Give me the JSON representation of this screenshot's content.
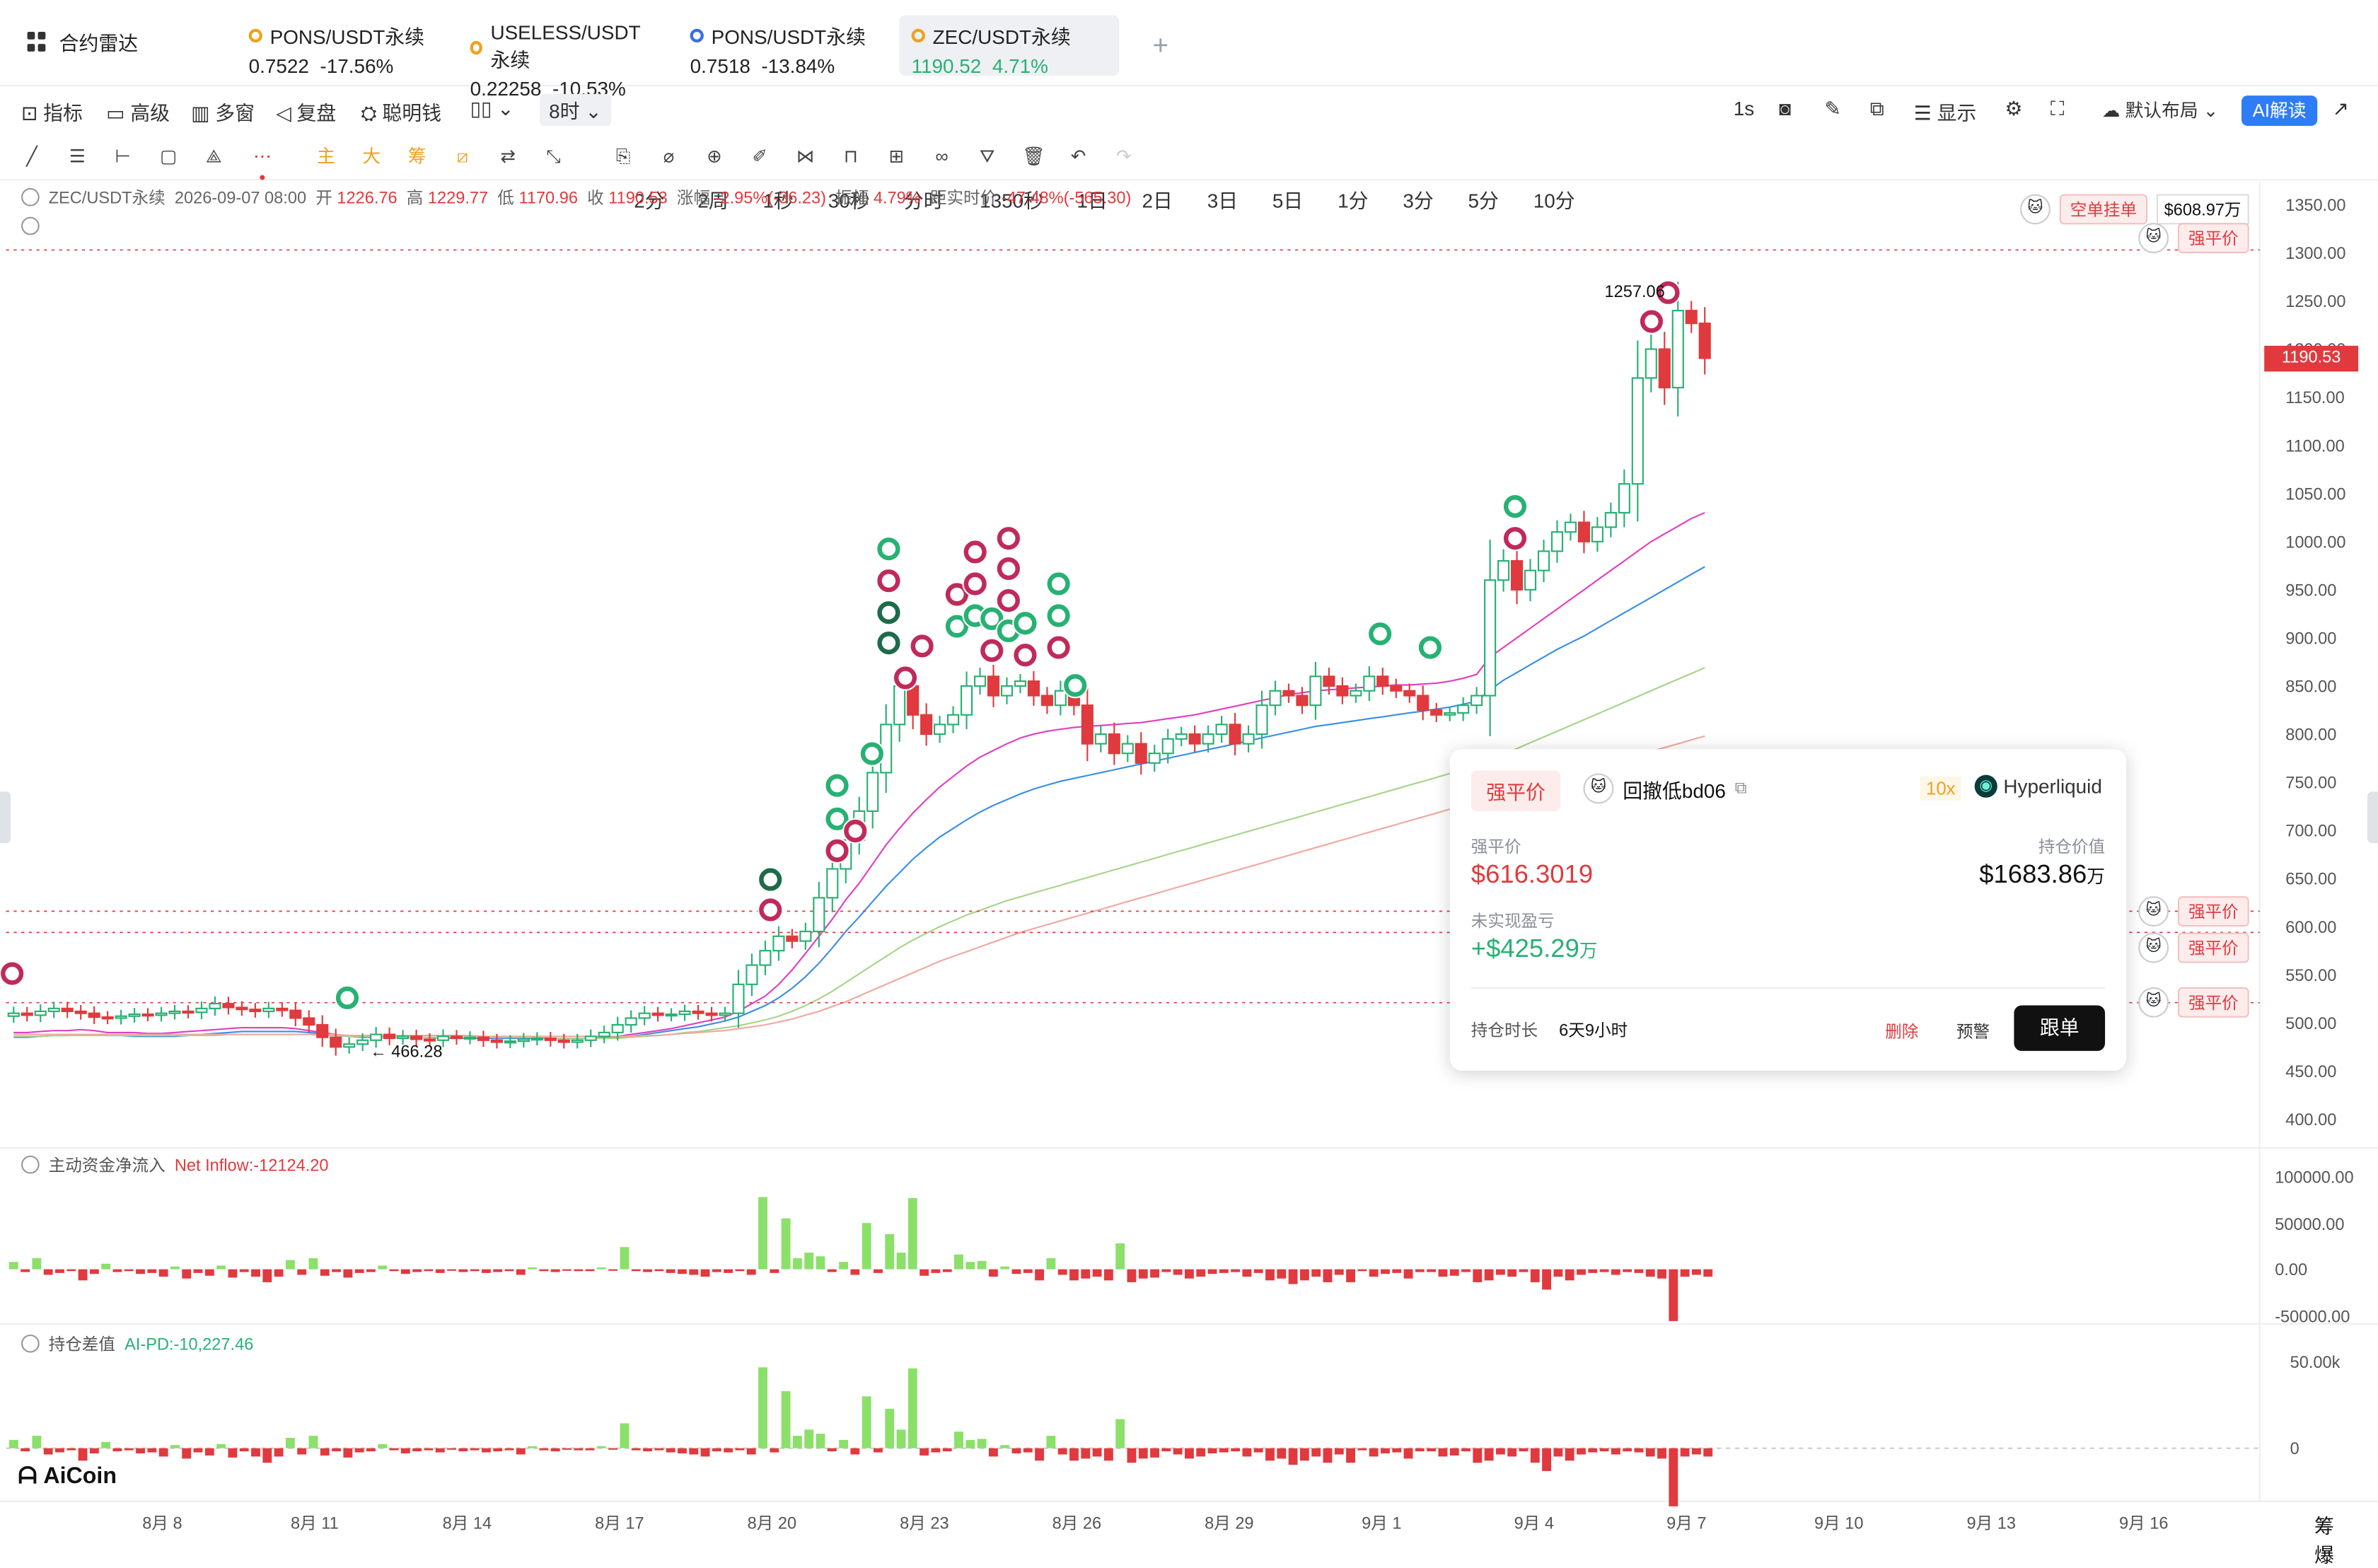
{
  "app": {
    "radar_label": "合约雷达",
    "tabs": [
      {
        "name": "PONS/USDT永续",
        "price": "0.7522",
        "change": "-17.56%",
        "active": false
      },
      {
        "name": "USELESS/USDT永续",
        "price": "0.22258",
        "change": "-10.53%",
        "active": false
      },
      {
        "name": "PONS/USDT永续",
        "price": "0.7518",
        "change": "-13.84%",
        "active": false
      },
      {
        "name": "ZEC/USDT永续",
        "price": "1190.52",
        "change": "4.71%",
        "active": true
      }
    ],
    "plus": "+"
  },
  "toolbar": {
    "left": [
      "指标",
      "高级",
      "多窗",
      "复盘",
      "聪明钱"
    ],
    "interval_selected": "8时",
    "intervals": [
      "2分",
      "2周",
      "1秒",
      "30秒",
      "分时",
      "1350秒",
      "1日",
      "2日",
      "3日",
      "5日",
      "1分",
      "3分",
      "5分",
      "10分"
    ],
    "right_1s": "1s",
    "display": "显示",
    "layout": "默认布局",
    "ai": "AI解读"
  },
  "drawing_tools": {
    "main": "主",
    "big": "大",
    "chips": "筹"
  },
  "info_line": {
    "symbol": "ZEC/USDT永续",
    "datetime": "2026-09-07 08:00",
    "open_label": "开",
    "open": "1226.76",
    "high_label": "高",
    "high": "1229.77",
    "low_label": "低",
    "low": "1170.96",
    "close_label": "收",
    "close": "1190.53",
    "change_label": "涨幅",
    "change": "-2.95%(-36.23)",
    "amp_label": "振幅",
    "amp": "4.79%",
    "dist_label": "距实时价",
    "dist": "-47.48%(-565.30)"
  },
  "price_annotations": {
    "high_mark": "1257.06",
    "low_mark": "← 466.28",
    "last_price": "1190.53",
    "short_order_label": "空单挂单",
    "short_order_value": "$608.97万",
    "liq_label": "强平价"
  },
  "card": {
    "tag": "强平价",
    "user": "回撤低bd06",
    "leverage": "10x",
    "exchange": "Hyperliquid",
    "liq_label": "强平价",
    "liq_value": "$616.3019",
    "pos_label": "持仓价值",
    "pos_value": "$1683.86",
    "pos_unit": "万",
    "pnl_label": "未实现盈亏",
    "pnl_value": "+$425.29",
    "pnl_unit": "万",
    "hold_label": "持仓时长",
    "hold_value": "6天9小时",
    "delete": "删除",
    "alert": "预警",
    "follow": "跟单"
  },
  "panel_labels": {
    "inflow_title": "主动资金净流入",
    "inflow_value": "Net Inflow:-12124.20",
    "pd_title": "持仓差值",
    "pd_value": "AI-PD:-10,227.46",
    "brand": "AiCoin",
    "corner": "筹 爆"
  },
  "colors": {
    "up": "#27b173",
    "down": "#e03a3e",
    "ma1": "#e040c0",
    "ma2": "#3a8ee6",
    "ma3": "#a8d48a",
    "ma4": "#f0a8a0",
    "bar_up": "#8be06a",
    "bar_down": "#e03a3e"
  },
  "chart_data": [
    {
      "type": "candlestick",
      "title": "ZEC/USDT永续 8时",
      "x_ticks": [
        "8月 8",
        "8月 11",
        "8月 14",
        "8月 17",
        "8月 20",
        "8月 23",
        "8月 26",
        "8月 29",
        "9月 1",
        "9月 4",
        "9月 7",
        "9月 10",
        "9月 13",
        "9月 16"
      ],
      "y_ticks": [
        1350,
        1300,
        1250,
        1200,
        1150,
        1100,
        1050,
        1000,
        950,
        900,
        850,
        800,
        750,
        700,
        650,
        600,
        550,
        500,
        450,
        400
      ],
      "ylim": [
        380,
        1370
      ],
      "liquidation_lines": [
        1303,
        616,
        594,
        521
      ],
      "closes": [
        510,
        508,
        512,
        515,
        512,
        510,
        506,
        505,
        507,
        509,
        508,
        510,
        512,
        511,
        515,
        520,
        516,
        514,
        512,
        515,
        513,
        505,
        498,
        485,
        475,
        478,
        482,
        488,
        484,
        486,
        483,
        482,
        486,
        484,
        485,
        482,
        480,
        481,
        483,
        484,
        482,
        480,
        482,
        486,
        490,
        498,
        505,
        510,
        508,
        509,
        512,
        510,
        508,
        510,
        540,
        560,
        575,
        590,
        585,
        595,
        630,
        660,
        690,
        720,
        760,
        810,
        850,
        820,
        800,
        810,
        820,
        850,
        860,
        840,
        850,
        855,
        840,
        830,
        845,
        830,
        790,
        800,
        780,
        790,
        770,
        780,
        795,
        800,
        790,
        800,
        810,
        790,
        800,
        830,
        845,
        840,
        830,
        860,
        850,
        840,
        845,
        860,
        850,
        845,
        840,
        825,
        820,
        822,
        830,
        840,
        960,
        980,
        950,
        970,
        990,
        1010,
        1020,
        1000,
        1015,
        1030,
        1060,
        1170,
        1200,
        1160,
        1240,
        1226.76,
        1190.53
      ],
      "ma_series": [
        {
          "name": "MA1",
          "values": [
            490,
            490,
            491,
            492,
            492,
            493,
            492,
            490,
            490,
            490,
            489,
            489,
            490,
            491,
            492,
            493,
            494,
            495,
            495,
            495,
            495,
            494,
            492,
            490,
            488,
            486,
            486,
            486,
            485,
            485,
            485,
            485,
            485,
            485,
            485,
            485,
            484,
            484,
            484,
            484,
            484,
            484,
            484,
            484,
            485,
            486,
            488,
            490,
            492,
            494,
            497,
            500,
            503,
            506,
            512,
            520,
            528,
            540,
            555,
            572,
            590,
            608,
            628,
            645,
            665,
            685,
            702,
            718,
            732,
            745,
            756,
            767,
            776,
            783,
            790,
            796,
            800,
            803,
            805,
            807,
            808,
            809,
            810,
            811,
            812,
            814,
            816,
            818,
            820,
            823,
            826,
            829,
            832,
            835,
            838,
            841,
            843,
            845,
            846,
            847,
            848,
            849,
            850,
            851,
            851,
            852,
            853,
            855,
            858,
            862,
            880,
            890,
            900,
            910,
            920,
            930,
            940,
            950,
            960,
            970,
            980,
            990,
            1000,
            1008,
            1016,
            1024,
            1030
          ]
        },
        {
          "name": "MA2",
          "values": [
            485,
            485,
            486,
            487,
            487,
            488,
            488,
            487,
            487,
            486,
            486,
            486,
            486,
            487,
            488,
            489,
            490,
            491,
            491,
            491,
            491,
            491,
            490,
            489,
            487,
            486,
            485,
            485,
            485,
            485,
            485,
            485,
            484,
            484,
            484,
            484,
            484,
            484,
            484,
            484,
            484,
            484,
            484,
            484,
            484,
            485,
            486,
            488,
            490,
            492,
            494,
            496,
            499,
            502,
            506,
            512,
            518,
            526,
            536,
            548,
            562,
            578,
            595,
            610,
            626,
            642,
            656,
            670,
            682,
            693,
            702,
            711,
            719,
            726,
            732,
            738,
            743,
            747,
            751,
            754,
            757,
            760,
            763,
            766,
            769,
            772,
            775,
            778,
            781,
            784,
            787,
            790,
            793,
            796,
            799,
            802,
            805,
            808,
            810,
            812,
            814,
            816,
            818,
            820,
            822,
            824,
            826,
            828,
            831,
            834,
            846,
            856,
            864,
            872,
            880,
            888,
            895,
            902,
            910,
            918,
            926,
            934,
            942,
            950,
            958,
            966,
            974
          ]
        },
        {
          "name": "MA3",
          "values": [
            486,
            486,
            486,
            487,
            487,
            487,
            487,
            487,
            487,
            487,
            487,
            487,
            487,
            487,
            487,
            487,
            488,
            488,
            488,
            488,
            488,
            488,
            488,
            487,
            487,
            486,
            486,
            486,
            485,
            485,
            485,
            485,
            485,
            485,
            485,
            485,
            485,
            485,
            485,
            485,
            484,
            484,
            484,
            484,
            484,
            484,
            485,
            486,
            487,
            488,
            490,
            491,
            493,
            495,
            497,
            500,
            503,
            507,
            512,
            518,
            525,
            533,
            542,
            551,
            560,
            569,
            578,
            586,
            593,
            600,
            606,
            612,
            617,
            622,
            627,
            631,
            635,
            639,
            643,
            647,
            651,
            655,
            659,
            663,
            667,
            671,
            675,
            679,
            683,
            687,
            691,
            695,
            699,
            703,
            707,
            711,
            715,
            719,
            723,
            727,
            731,
            735,
            739,
            743,
            747,
            751,
            755,
            759,
            763,
            767,
            773,
            779,
            785,
            791,
            797,
            803,
            809,
            815,
            821,
            827,
            833,
            839,
            845,
            851,
            857,
            863,
            869
          ]
        },
        {
          "name": "MA4",
          "values": [
            488,
            488,
            488,
            488,
            488,
            488,
            488,
            488,
            488,
            488,
            488,
            488,
            488,
            488,
            488,
            488,
            488,
            488,
            488,
            488,
            488,
            488,
            488,
            488,
            488,
            487,
            487,
            487,
            487,
            487,
            487,
            487,
            487,
            487,
            487,
            486,
            486,
            486,
            486,
            486,
            486,
            486,
            486,
            486,
            486,
            486,
            486,
            487,
            487,
            488,
            489,
            490,
            491,
            492,
            494,
            496,
            498,
            501,
            504,
            508,
            512,
            517,
            522,
            528,
            534,
            540,
            546,
            552,
            558,
            564,
            569,
            574,
            579,
            584,
            589,
            594,
            598,
            602,
            606,
            610,
            614,
            618,
            622,
            626,
            630,
            634,
            638,
            642,
            646,
            650,
            654,
            658,
            662,
            666,
            670,
            674,
            678,
            682,
            686,
            690,
            694,
            698,
            702,
            706,
            710,
            714,
            718,
            722,
            726,
            730,
            734,
            738,
            742,
            746,
            750,
            754,
            758,
            762,
            766,
            770,
            774,
            778,
            782,
            786,
            790,
            794,
            798
          ]
        }
      ]
    },
    {
      "type": "bar",
      "title": "主动资金净流入",
      "y_ticks": [
        "100000.00",
        "50000.00",
        "0.00",
        "-50000.00"
      ],
      "ylim": [
        -60000,
        110000
      ],
      "values": [
        8000,
        -3000,
        12000,
        -6000,
        -4000,
        -2000,
        -12000,
        -5000,
        6000,
        -3000,
        -2000,
        -5000,
        -4000,
        -8000,
        3000,
        -10000,
        -4000,
        -7000,
        4000,
        -9000,
        -3000,
        -8000,
        -14000,
        -8000,
        10000,
        -6000,
        12000,
        -7000,
        -3000,
        -9000,
        -4000,
        -3000,
        4000,
        -2000,
        -5000,
        -3000,
        -2000,
        -4000,
        -1000,
        -3000,
        -2000,
        -4000,
        -3000,
        -2000,
        -6000,
        2000,
        -2000,
        -3000,
        -1000,
        -2000,
        -2000,
        2000,
        -1000,
        24000,
        -2000,
        -3000,
        -2000,
        -4000,
        -5000,
        -6000,
        -8000,
        -3000,
        -4000,
        -2000,
        -6000,
        78000,
        -4000,
        55000,
        12000,
        18000,
        14000,
        -3000,
        8000,
        -6000,
        50000,
        -4000,
        38000,
        18000,
        77000,
        -7000,
        -4000,
        -3000,
        16000,
        8000,
        9000,
        -8000,
        3000,
        -5000,
        -4000,
        -12000,
        12000,
        -6000,
        -12000,
        -10000,
        -8000,
        -12000,
        28000,
        -14000,
        -10000,
        -9000,
        -3000,
        -6000,
        -10000,
        -8000,
        -5000,
        -4000,
        -3000,
        -8000,
        -4000,
        -12000,
        -10000,
        -16000,
        -12000,
        -8000,
        -14000,
        -6000,
        -14000,
        -2000,
        -8000,
        -5000,
        -4000,
        -10000,
        -3000,
        -3000,
        -8000,
        -7000,
        -3000,
        -14000,
        -12000,
        -6000,
        -8000,
        -3000,
        -14000,
        -22000,
        -8000,
        -12000,
        -6000,
        -4000,
        -3000,
        -6000,
        -3000,
        -4000,
        -8000,
        -10000,
        -56000,
        -8000,
        -6000,
        -8000,
        -8000,
        -8000,
        -10000,
        -6000,
        -14000,
        -8000,
        -16000,
        -5000,
        -14000,
        -6000,
        -3000,
        -8000,
        -9000,
        -6000,
        -8000,
        -10000,
        -6000,
        -4000,
        -12000,
        -14000,
        -10000,
        -4000,
        -9000,
        -14000,
        -6000,
        -10000,
        -12000,
        -8000,
        -14000,
        -10000,
        -18000,
        -20000,
        -4000,
        -24000,
        -8000,
        -28000,
        -6000,
        -12000,
        -8000,
        -24000,
        -6000,
        -26000,
        -14000,
        -2000,
        -6000,
        -10000,
        -10000
      ]
    },
    {
      "type": "bar",
      "title": "持仓差值",
      "y_ticks": [
        "50.00k",
        "0"
      ],
      "ylim": [
        -50000,
        70000
      ]
    }
  ]
}
